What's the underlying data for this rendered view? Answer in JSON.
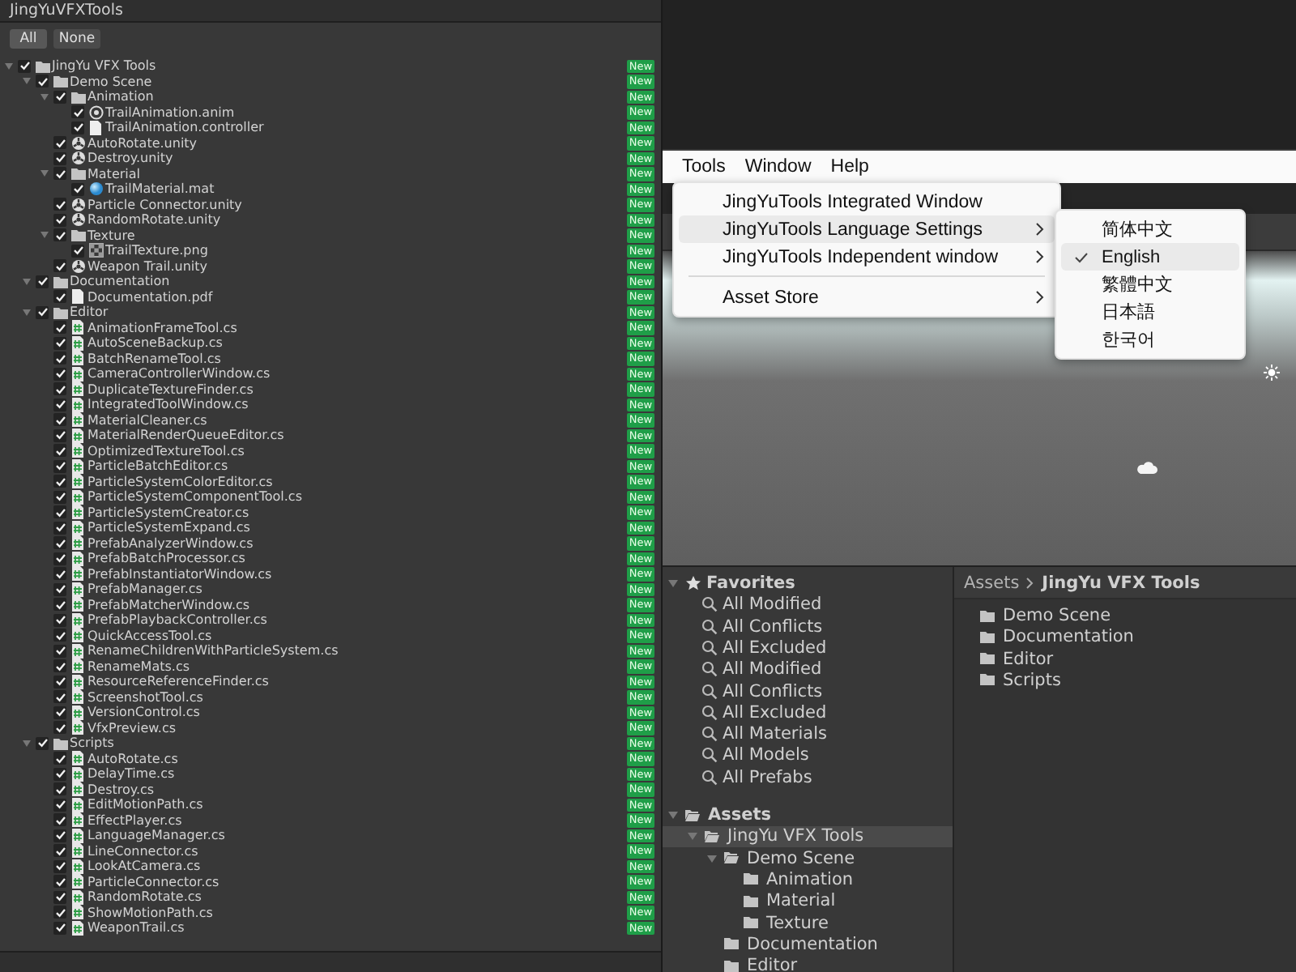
{
  "import_window": {
    "title": "JingYuVFXTools",
    "buttons": [
      "All",
      "None"
    ],
    "tree": [
      {
        "name": "JingYu VFX Tools",
        "kind": "folder",
        "checked": true,
        "expanded": true,
        "badge": "New",
        "children": [
          {
            "name": "Demo Scene",
            "kind": "folder",
            "checked": true,
            "expanded": true,
            "badge": "New",
            "children": [
              {
                "name": "Animation",
                "kind": "folder",
                "checked": true,
                "expanded": true,
                "badge": "New",
                "children": [
                  {
                    "name": "TrailAnimation.anim",
                    "kind": "anim",
                    "checked": true,
                    "badge": "New"
                  },
                  {
                    "name": "TrailAnimation.controller",
                    "kind": "controller",
                    "checked": true,
                    "badge": "New"
                  }
                ]
              },
              {
                "name": "AutoRotate.unity",
                "kind": "scene",
                "checked": true,
                "badge": "New"
              },
              {
                "name": "Destroy.unity",
                "kind": "scene",
                "checked": true,
                "badge": "New"
              },
              {
                "name": "Material",
                "kind": "folder",
                "checked": true,
                "expanded": true,
                "badge": "New",
                "children": [
                  {
                    "name": "TrailMaterial.mat",
                    "kind": "material",
                    "checked": true,
                    "badge": "New"
                  }
                ]
              },
              {
                "name": "Particle Connector.unity",
                "kind": "scene",
                "checked": true,
                "badge": "New"
              },
              {
                "name": "RandomRotate.unity",
                "kind": "scene",
                "checked": true,
                "badge": "New"
              },
              {
                "name": "Texture",
                "kind": "folder",
                "checked": true,
                "expanded": true,
                "badge": "New",
                "children": [
                  {
                    "name": "TrailTexture.png",
                    "kind": "texture",
                    "checked": true,
                    "badge": "New"
                  }
                ]
              },
              {
                "name": "Weapon Trail.unity",
                "kind": "scene",
                "checked": true,
                "badge": "New"
              }
            ]
          },
          {
            "name": "Documentation",
            "kind": "folder",
            "checked": true,
            "expanded": true,
            "badge": "New",
            "children": [
              {
                "name": "Documentation.pdf",
                "kind": "pdf",
                "checked": true,
                "badge": "New"
              }
            ]
          },
          {
            "name": "Editor",
            "kind": "folder",
            "checked": true,
            "expanded": true,
            "badge": "New",
            "children": [
              {
                "name": "AnimationFrameTool.cs",
                "kind": "script",
                "checked": true,
                "badge": "New"
              },
              {
                "name": "AutoSceneBackup.cs",
                "kind": "script",
                "checked": true,
                "badge": "New"
              },
              {
                "name": "BatchRenameTool.cs",
                "kind": "script",
                "checked": true,
                "badge": "New"
              },
              {
                "name": "CameraControllerWindow.cs",
                "kind": "script",
                "checked": true,
                "badge": "New"
              },
              {
                "name": "DuplicateTextureFinder.cs",
                "kind": "script",
                "checked": true,
                "badge": "New"
              },
              {
                "name": "IntegratedToolWindow.cs",
                "kind": "script",
                "checked": true,
                "badge": "New"
              },
              {
                "name": "MaterialCleaner.cs",
                "kind": "script",
                "checked": true,
                "badge": "New"
              },
              {
                "name": "MaterialRenderQueueEditor.cs",
                "kind": "script",
                "checked": true,
                "badge": "New"
              },
              {
                "name": "OptimizedTextureTool.cs",
                "kind": "script",
                "checked": true,
                "badge": "New"
              },
              {
                "name": "ParticleBatchEditor.cs",
                "kind": "script",
                "checked": true,
                "badge": "New"
              },
              {
                "name": "ParticleSystemColorEditor.cs",
                "kind": "script",
                "checked": true,
                "badge": "New"
              },
              {
                "name": "ParticleSystemComponentTool.cs",
                "kind": "script",
                "checked": true,
                "badge": "New"
              },
              {
                "name": "ParticleSystemCreator.cs",
                "kind": "script",
                "checked": true,
                "badge": "New"
              },
              {
                "name": "ParticleSystemExpand.cs",
                "kind": "script",
                "checked": true,
                "badge": "New"
              },
              {
                "name": "PrefabAnalyzerWindow.cs",
                "kind": "script",
                "checked": true,
                "badge": "New"
              },
              {
                "name": "PrefabBatchProcessor.cs",
                "kind": "script",
                "checked": true,
                "badge": "New"
              },
              {
                "name": "PrefabInstantiatorWindow.cs",
                "kind": "script",
                "checked": true,
                "badge": "New"
              },
              {
                "name": "PrefabManager.cs",
                "kind": "script",
                "checked": true,
                "badge": "New"
              },
              {
                "name": "PrefabMatcherWindow.cs",
                "kind": "script",
                "checked": true,
                "badge": "New"
              },
              {
                "name": "PrefabPlaybackController.cs",
                "kind": "script",
                "checked": true,
                "badge": "New"
              },
              {
                "name": "QuickAccessTool.cs",
                "kind": "script",
                "checked": true,
                "badge": "New"
              },
              {
                "name": "RenameChildrenWithParticleSystem.cs",
                "kind": "script",
                "checked": true,
                "badge": "New"
              },
              {
                "name": "RenameMats.cs",
                "kind": "script",
                "checked": true,
                "badge": "New"
              },
              {
                "name": "ResourceReferenceFinder.cs",
                "kind": "script",
                "checked": true,
                "badge": "New"
              },
              {
                "name": "ScreenshotTool.cs",
                "kind": "script",
                "checked": true,
                "badge": "New"
              },
              {
                "name": "VersionControl.cs",
                "kind": "script",
                "checked": true,
                "badge": "New"
              },
              {
                "name": "VfxPreview.cs",
                "kind": "script",
                "checked": true,
                "badge": "New"
              }
            ]
          },
          {
            "name": "Scripts",
            "kind": "folder",
            "checked": true,
            "expanded": true,
            "badge": "New",
            "children": [
              {
                "name": "AutoRotate.cs",
                "kind": "script",
                "checked": true,
                "badge": "New"
              },
              {
                "name": "DelayTime.cs",
                "kind": "script",
                "checked": true,
                "badge": "New"
              },
              {
                "name": "Destroy.cs",
                "kind": "script",
                "checked": true,
                "badge": "New"
              },
              {
                "name": "EditMotionPath.cs",
                "kind": "script",
                "checked": true,
                "badge": "New"
              },
              {
                "name": "EffectPlayer.cs",
                "kind": "script",
                "checked": true,
                "badge": "New"
              },
              {
                "name": "LanguageManager.cs",
                "kind": "script",
                "checked": true,
                "badge": "New"
              },
              {
                "name": "LineConnector.cs",
                "kind": "script",
                "checked": true,
                "badge": "New"
              },
              {
                "name": "LookAtCamera.cs",
                "kind": "script",
                "checked": true,
                "badge": "New"
              },
              {
                "name": "ParticleConnector.cs",
                "kind": "script",
                "checked": true,
                "badge": "New"
              },
              {
                "name": "RandomRotate.cs",
                "kind": "script",
                "checked": true,
                "badge": "New"
              },
              {
                "name": "ShowMotionPath.cs",
                "kind": "script",
                "checked": true,
                "badge": "New"
              },
              {
                "name": "WeaponTrail.cs",
                "kind": "script",
                "checked": true,
                "badge": "New"
              }
            ]
          }
        ]
      }
    ]
  },
  "menu_bar": {
    "items": [
      {
        "label": "Tools"
      },
      {
        "label": "Window"
      },
      {
        "label": "Help"
      }
    ]
  },
  "tools_menu": {
    "items": [
      {
        "kind": "item",
        "label": "JingYuTools Integrated Window",
        "submenu": false,
        "highlighted": false
      },
      {
        "kind": "item",
        "label": "JingYuTools Language Settings",
        "submenu": true,
        "highlighted": true
      },
      {
        "kind": "item",
        "label": "JingYuTools Independent window",
        "submenu": true,
        "highlighted": false
      },
      {
        "kind": "separator"
      },
      {
        "kind": "item",
        "label": "Asset Store",
        "submenu": true,
        "highlighted": false
      }
    ]
  },
  "language_menu": {
    "items": [
      {
        "label": "简体中文",
        "selected": false
      },
      {
        "label": "English",
        "selected": true
      },
      {
        "label": "繁體中文",
        "selected": false
      },
      {
        "label": "日本語",
        "selected": false
      },
      {
        "label": "한국어",
        "selected": false
      }
    ]
  },
  "project": {
    "favorites": {
      "title": "Favorites",
      "expanded": true,
      "items": [
        "All Modified",
        "All Conflicts",
        "All Excluded",
        "All Modified",
        "All Conflicts",
        "All Excluded",
        "All Materials",
        "All Models",
        "All Prefabs"
      ]
    },
    "assets": [
      {
        "name": "Assets",
        "expanded": true,
        "selected": false,
        "children": [
          {
            "name": "JingYu VFX Tools",
            "expanded": true,
            "selected": true,
            "children": [
              {
                "name": "Demo Scene",
                "expanded": true,
                "selected": false,
                "children": [
                  {
                    "name": "Animation",
                    "selected": false
                  },
                  {
                    "name": "Material",
                    "selected": false
                  },
                  {
                    "name": "Texture",
                    "selected": false
                  }
                ]
              },
              {
                "name": "Documentation",
                "selected": false
              },
              {
                "name": "Editor",
                "selected": false
              }
            ]
          }
        ]
      }
    ],
    "breadcrumb": [
      "Assets",
      "JingYu VFX Tools"
    ],
    "folders": [
      "Demo Scene",
      "Documentation",
      "Editor",
      "Scripts"
    ]
  }
}
